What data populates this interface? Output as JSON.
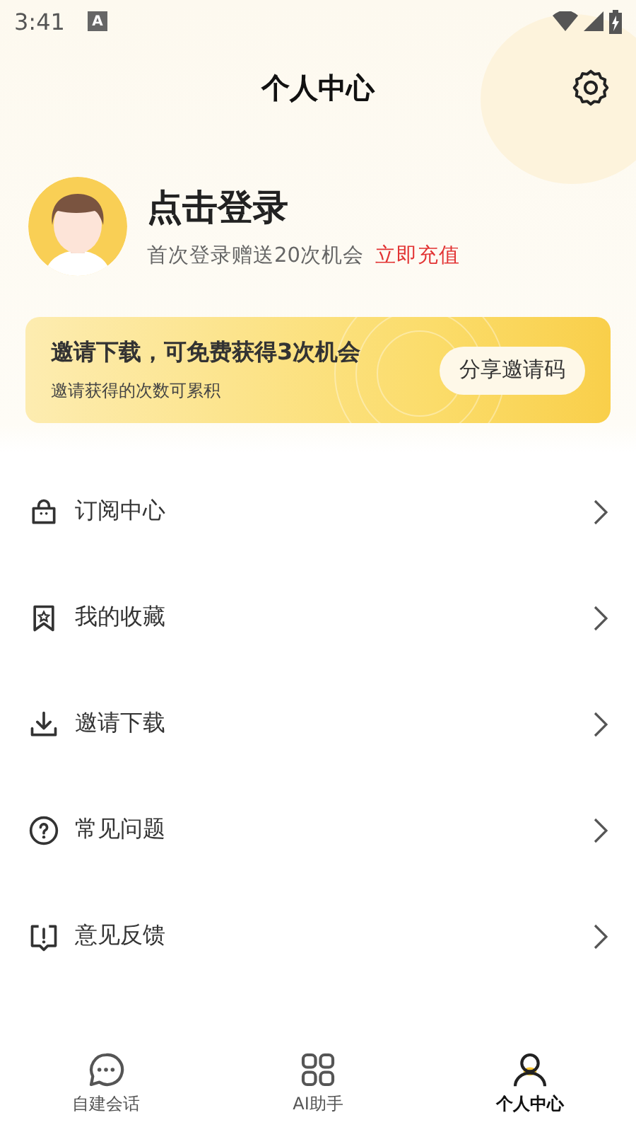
{
  "status_bar": {
    "time": "3:41",
    "badge": "A"
  },
  "header": {
    "title": "个人中心"
  },
  "profile": {
    "name": "点击登录",
    "note": "首次登录赠送20次机会",
    "link": "立即充值"
  },
  "invite_banner": {
    "title": "邀请下载，可免费获得3次机会",
    "subtitle": "邀请获得的次数可累积",
    "button": "分享邀请码"
  },
  "menu": [
    {
      "kind": "bag",
      "label": "订阅中心"
    },
    {
      "kind": "bookmark",
      "label": "我的收藏"
    },
    {
      "kind": "download",
      "label": "邀请下载"
    },
    {
      "kind": "question",
      "label": "常见问题"
    },
    {
      "kind": "feedback",
      "label": "意见反馈"
    }
  ],
  "tabs": [
    {
      "kind": "chat",
      "label": "自建会话",
      "selected": false
    },
    {
      "kind": "grid",
      "label": "AI助手",
      "selected": false
    },
    {
      "kind": "person",
      "label": "个人中心",
      "selected": true
    }
  ]
}
